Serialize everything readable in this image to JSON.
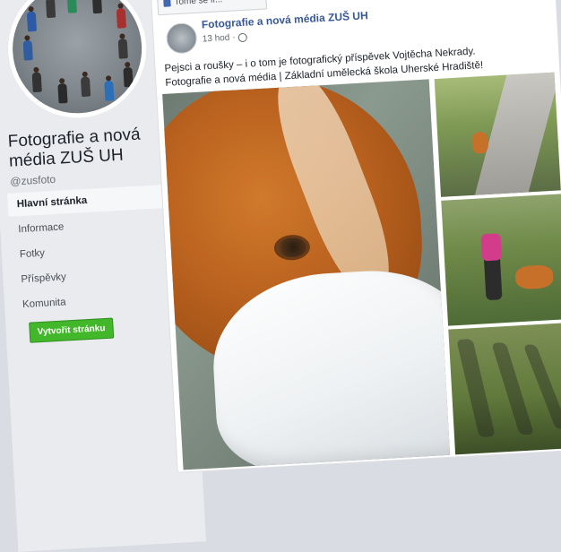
{
  "page": {
    "name": "Fotografie a nová média ZUŠ UH",
    "handle": "@zusfoto"
  },
  "nav": {
    "items": [
      "Hlavní stránka",
      "Informace",
      "Fotky",
      "Příspěvky",
      "Komunita"
    ],
    "active_index": 0,
    "create_button": "Vytvořit stránku"
  },
  "post": {
    "author": "Fotografie a nová média ZUŠ UH",
    "time": "13 hod",
    "text_line1": "Pejsci a roušky – i o tom je fotografický příspěvek Vojtěcha Nekrady.",
    "text_line2": "Fotografie a nová média | Základní umělecká škola Uherské Hradiště!",
    "top_action": "Tome se lí...",
    "icons": {
      "more": "more-horizontal-icon",
      "privacy": "globe-icon"
    }
  },
  "colors": {
    "link": "#385898",
    "create_button": "#42b72a",
    "sidebar_bg": "#e9ebee"
  }
}
